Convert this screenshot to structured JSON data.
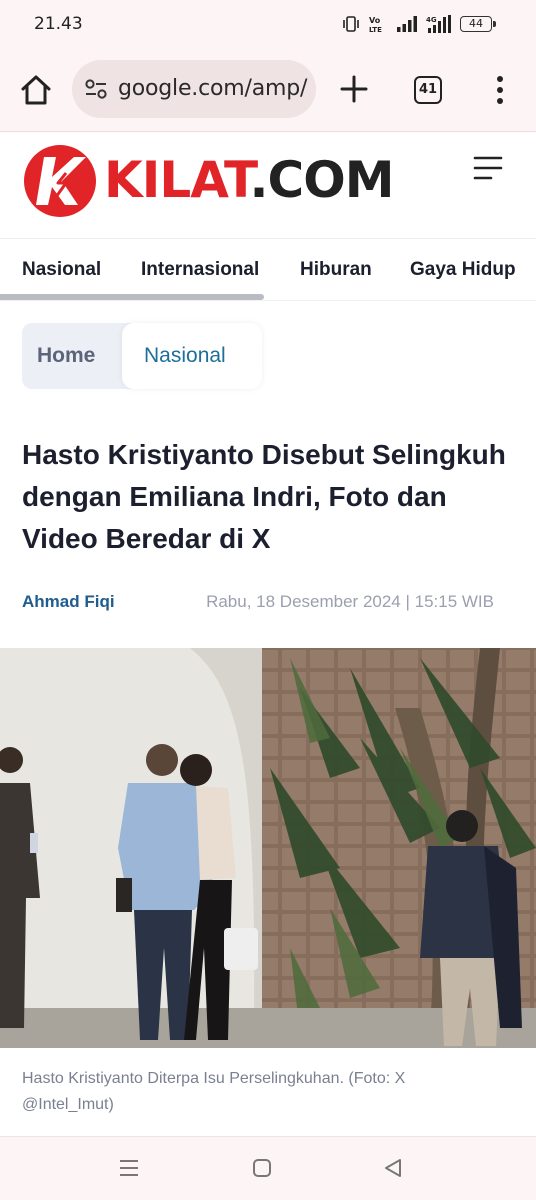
{
  "status_bar": {
    "time": "21.43",
    "volte_label": "Vo LTE",
    "network": "4G",
    "battery_level": "44"
  },
  "browser": {
    "url": "google.com/amp/",
    "tab_count": "41"
  },
  "site": {
    "logo_kilat": "KILAT",
    "logo_com": ".COM",
    "brand_color": "#e02428"
  },
  "categories": [
    "Nasional",
    "Internasional",
    "Hiburan",
    "Gaya Hidup"
  ],
  "breadcrumb": {
    "home": "Home",
    "current": "Nasional"
  },
  "article": {
    "headline": "Hasto Kristiyanto Disebut Selingkuh dengan Emiliana Indri, Foto dan Video Beredar di X",
    "author": "Ahmad Fiqi",
    "published": "Rabu, 18 Desember 2024 | 15:15 WIB",
    "caption": "Hasto Kristiyanto Diterpa Isu Perselingkuhan. (Foto: X @Intel_Imut)"
  },
  "icons": {
    "home": "home-icon",
    "site_settings": "tune-icon",
    "new_tab": "plus-icon",
    "menu": "more-vert-icon",
    "hamburger": "hamburger-icon"
  }
}
